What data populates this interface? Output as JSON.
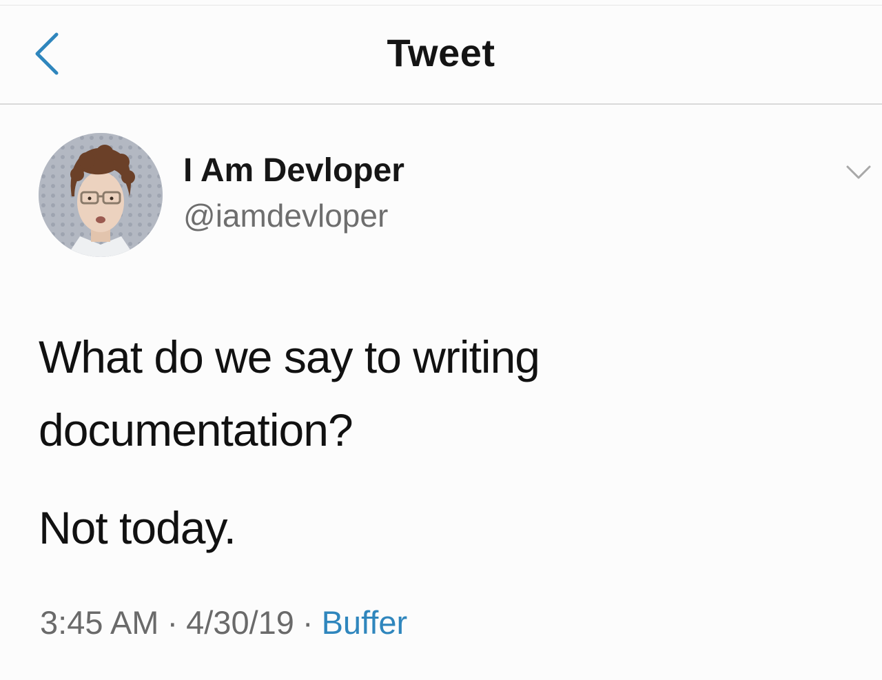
{
  "header": {
    "title": "Tweet",
    "back_icon": "chevron-left-icon",
    "accent_color": "#2f86bd"
  },
  "tweet": {
    "user": {
      "display_name": "I Am Devloper",
      "handle": "@iamdevloper",
      "avatar": "avatar-photo"
    },
    "more_icon": "chevron-down-icon",
    "text_lines": [
      "What do we say to writing documentation?",
      "Not today."
    ],
    "time": "3:45 AM",
    "separator": "·",
    "date": "4/30/19",
    "source": "Buffer"
  }
}
